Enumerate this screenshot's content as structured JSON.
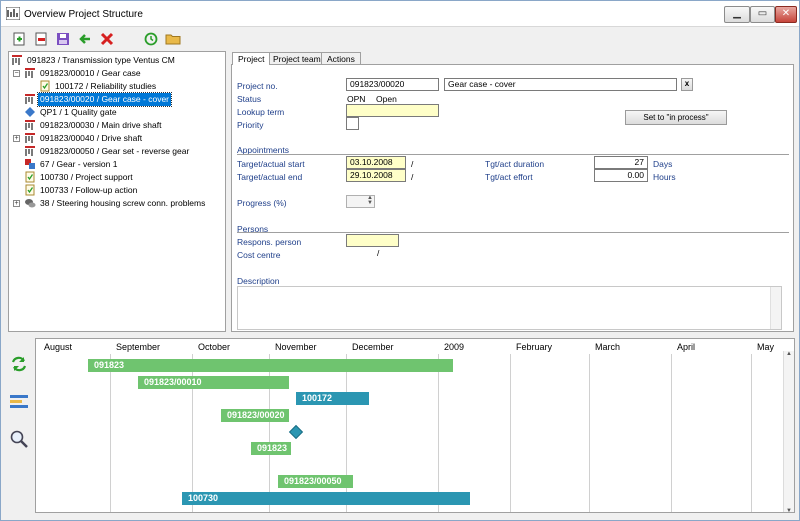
{
  "window": {
    "title": "Overview Project Structure"
  },
  "tree": [
    {
      "label": "091823 / Transmission type Ventus CM",
      "icon": "project-icon",
      "indent": 0,
      "expander": ""
    },
    {
      "label": "091823/00010 / Gear case",
      "icon": "project-icon",
      "indent": 1,
      "expander": "−"
    },
    {
      "label": "100172 / Reliability studies",
      "icon": "task-icon",
      "indent": 2,
      "expander": ""
    },
    {
      "label": "091823/00020 / Gear case - cover",
      "icon": "project-icon",
      "indent": 1,
      "expander": "",
      "selected": true
    },
    {
      "label": "QP1 / 1 Quality gate",
      "icon": "milestone-icon",
      "indent": 1,
      "expander": ""
    },
    {
      "label": "091823/00030 / Main drive shaft",
      "icon": "project-icon",
      "indent": 1,
      "expander": ""
    },
    {
      "label": "091823/00040 / Drive shaft",
      "icon": "project-icon",
      "indent": 1,
      "expander": "+"
    },
    {
      "label": "091823/00050 / Gear set - reverse gear",
      "icon": "project-icon",
      "indent": 1,
      "expander": ""
    },
    {
      "label": "67 / Gear - version 1",
      "icon": "product-icon",
      "indent": 1,
      "expander": ""
    },
    {
      "label": "100730 / Project support",
      "icon": "task-icon",
      "indent": 1,
      "expander": ""
    },
    {
      "label": "100733 / Follow-up action",
      "icon": "task-icon",
      "indent": 1,
      "expander": ""
    },
    {
      "label": "38 / Steering housing screw conn. problems",
      "icon": "issue-icon",
      "indent": 1,
      "expander": "+"
    }
  ],
  "tabs": [
    "Project",
    "Project team",
    "Actions"
  ],
  "form": {
    "project_no_label": "Project no.",
    "project_no": "091823/00020",
    "project_name": "Gear case - cover",
    "clear_label": "x",
    "status_label": "Status",
    "status_code": "OPN",
    "status_text": "Open",
    "lookup_label": "Lookup term",
    "priority_label": "Priority",
    "set_in_process_label": "Set to \"in process\"",
    "appointments_label": "Appointments",
    "start_label": "Target/actual start",
    "start_value": "03.10.2008",
    "start_sep": "/",
    "end_label": "Target/actual end",
    "end_value": "29.10.2008",
    "end_sep": "/",
    "duration_label": "Tgt/act duration",
    "duration_value": "27",
    "duration_unit": "Days",
    "effort_label": "Tgt/act effort",
    "effort_value": "0.00",
    "effort_unit": "Hours",
    "progress_label": "Progress (%)",
    "persons_label": "Persons",
    "responsible_label": "Respons. person",
    "cost_centre_label": "Cost centre",
    "cost_centre_sep": "/",
    "description_label": "Description"
  },
  "gantt": {
    "months": [
      "August",
      "September",
      "October",
      "November",
      "December",
      "2009",
      "February",
      "March",
      "April",
      "May"
    ],
    "bars": [
      {
        "label": "091823",
        "color": "green"
      },
      {
        "label": "091823/00010",
        "color": "green"
      },
      {
        "label": "100172",
        "color": "teal"
      },
      {
        "label": "091823/00020",
        "color": "green"
      },
      {
        "label": "091823",
        "color": "green"
      },
      {
        "label": "091823/00050",
        "color": "green"
      },
      {
        "label": "100730",
        "color": "teal"
      }
    ]
  },
  "colors": {
    "accent": "#0078d7",
    "green_bar": "#6fc46f",
    "teal_bar": "#2b96b2",
    "label_blue": "#1f3f8a",
    "field_yellow": "#ffffc8"
  }
}
